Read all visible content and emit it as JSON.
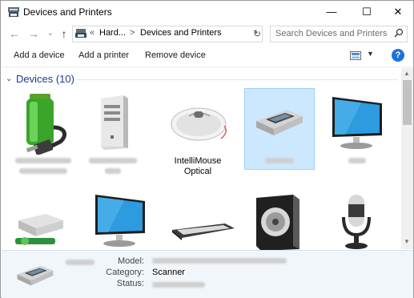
{
  "window": {
    "title": "Devices and Printers"
  },
  "address": {
    "root_chevron": "«",
    "crumb1": "Hard...",
    "sep": ">",
    "crumb2": "Devices and Printers",
    "dropdown": "⌄"
  },
  "search": {
    "placeholder": "Search Devices and Printers"
  },
  "toolbar": {
    "add_device": "Add a device",
    "add_printer": "Add a printer",
    "remove_device": "Remove device",
    "help": "?"
  },
  "group": {
    "title": "Devices (10)"
  },
  "devices": [
    {
      "name": "",
      "icon": "battery-usb-icon"
    },
    {
      "name": "",
      "icon": "tower-computer-icon"
    },
    {
      "name": "IntelliMouse Optical",
      "icon": "mouse-icon"
    },
    {
      "name": "",
      "icon": "scanner-icon",
      "selected": true
    },
    {
      "name": "",
      "icon": "monitor-icon"
    },
    {
      "name": "",
      "icon": "network-drive-icon"
    },
    {
      "name": "",
      "icon": "monitor-icon"
    },
    {
      "name": "",
      "icon": "keyboard-icon"
    },
    {
      "name": "",
      "icon": "speaker-icon"
    },
    {
      "name": "",
      "icon": "microphone-icon"
    }
  ],
  "details": {
    "model_label": "Model:",
    "model_value": "",
    "category_label": "Category:",
    "category_value": "Scanner",
    "status_label": "Status:",
    "status_value": ""
  },
  "colors": {
    "accent": "#1e73d8",
    "selection": "#cce8ff",
    "group_header": "#1e3a8a"
  }
}
